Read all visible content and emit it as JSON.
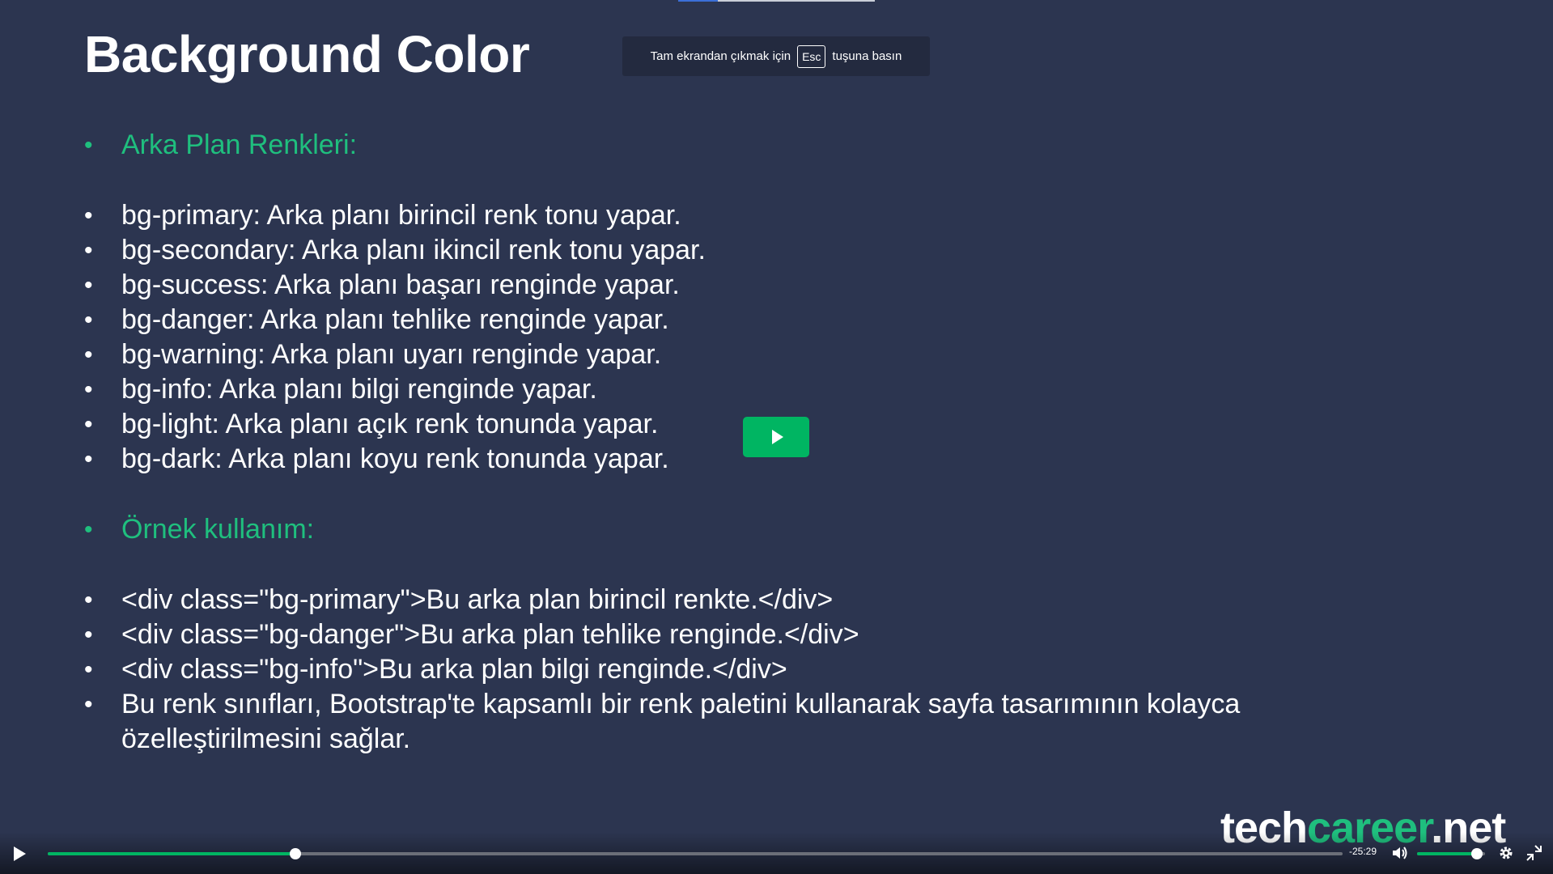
{
  "slide": {
    "title": "Background Color",
    "section1_heading": "Arka Plan Renkleri:",
    "classes": [
      "bg-primary: Arka planı birincil renk tonu yapar.",
      "bg-secondary: Arka planı ikincil renk tonu yapar.",
      "bg-success: Arka planı başarı renginde yapar.",
      "bg-danger: Arka planı tehlike renginde yapar.",
      "bg-warning: Arka planı uyarı renginde yapar.",
      "bg-info: Arka planı bilgi renginde yapar.",
      "bg-light: Arka planı açık renk tonunda yapar.",
      "bg-dark: Arka planı koyu renk tonunda yapar."
    ],
    "section2_heading": "Örnek kullanım:",
    "examples": [
      "<div class=\"bg-primary\">Bu arka plan birincil renkte.</div>",
      "<div class=\"bg-danger\">Bu arka plan tehlike renginde.</div>",
      "<div class=\"bg-info\">Bu arka plan bilgi renginde.</div>",
      "Bu renk sınıfları, Bootstrap'te kapsamlı bir renk paletini kullanarak sayfa tasarımının kolayca özelleştirilmesini sağlar."
    ]
  },
  "fullscreen_notice": {
    "before": "Tam ekrandan çıkmak için",
    "key": "Esc",
    "after": "tuşuna basın"
  },
  "logo": {
    "part1": "tech",
    "part2": "career",
    "part3": ".net"
  },
  "player": {
    "time_remaining": "-25:29",
    "progress_fraction": 0.191,
    "volume_fraction": 0.88,
    "top_progress_fraction": 0.2
  },
  "colors": {
    "background": "#2c3550",
    "accent_green": "#1fbf7e",
    "button_green": "#00b562"
  },
  "icons": {
    "play": "play-icon",
    "volume": "volume-icon",
    "settings": "gear-icon",
    "exit_fullscreen": "exit-fullscreen-icon"
  }
}
